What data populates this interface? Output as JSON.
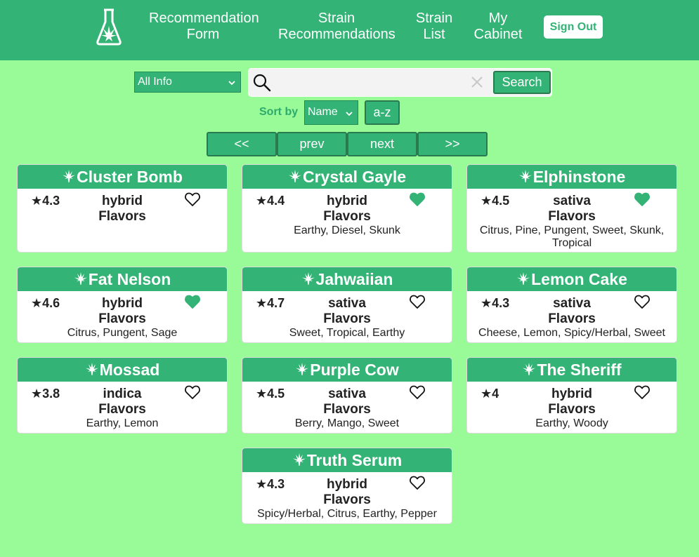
{
  "nav": {
    "links": [
      "Recommendation\nForm",
      "Strain\nRecommendations",
      "Strain\nList",
      "My\nCabinet"
    ],
    "signout": "Sign Out"
  },
  "search": {
    "filter": "All Info",
    "placeholder": "",
    "value": "",
    "button": "Search",
    "clear_icon": "close-icon"
  },
  "sort": {
    "label": "Sort by",
    "field": "Name",
    "order": "a-z"
  },
  "pager": [
    "<<",
    "prev",
    "next",
    ">>"
  ],
  "colors": {
    "primary": "#33b375",
    "background": "#98fb98",
    "favorite": "#33b375"
  },
  "strains": [
    {
      "name": "Cluster Bomb",
      "rating": "4.3",
      "type": "hybrid",
      "flavors_label": "Flavors",
      "flavors": "",
      "favorite": false
    },
    {
      "name": "Crystal Gayle",
      "rating": "4.4",
      "type": "hybrid",
      "flavors_label": "Flavors",
      "flavors": "Earthy, Diesel, Skunk",
      "favorite": true
    },
    {
      "name": "Elphinstone",
      "rating": "4.5",
      "type": "sativa",
      "flavors_label": "Flavors",
      "flavors": "Citrus, Pine, Pungent, Sweet, Skunk, Tropical",
      "favorite": true
    },
    {
      "name": "Fat Nelson",
      "rating": "4.6",
      "type": "hybrid",
      "flavors_label": "Flavors",
      "flavors": "Citrus, Pungent, Sage",
      "favorite": true
    },
    {
      "name": "Jahwaiian",
      "rating": "4.7",
      "type": "sativa",
      "flavors_label": "Flavors",
      "flavors": "Sweet, Tropical, Earthy",
      "favorite": false
    },
    {
      "name": "Lemon Cake",
      "rating": "4.3",
      "type": "sativa",
      "flavors_label": "Flavors",
      "flavors": "Cheese, Lemon, Spicy/Herbal, Sweet",
      "favorite": false
    },
    {
      "name": "Mossad",
      "rating": "3.8",
      "type": "indica",
      "flavors_label": "Flavors",
      "flavors": "Earthy, Lemon",
      "favorite": false
    },
    {
      "name": "Purple Cow",
      "rating": "4.5",
      "type": "sativa",
      "flavors_label": "Flavors",
      "flavors": "Berry, Mango, Sweet",
      "favorite": false
    },
    {
      "name": "The Sheriff",
      "rating": "4",
      "type": "hybrid",
      "flavors_label": "Flavors",
      "flavors": "Earthy, Woody",
      "favorite": false
    },
    {
      "name": "Truth Serum",
      "rating": "4.3",
      "type": "hybrid",
      "flavors_label": "Flavors",
      "flavors": "Spicy/Herbal, Citrus, Earthy, Pepper",
      "favorite": false
    }
  ]
}
